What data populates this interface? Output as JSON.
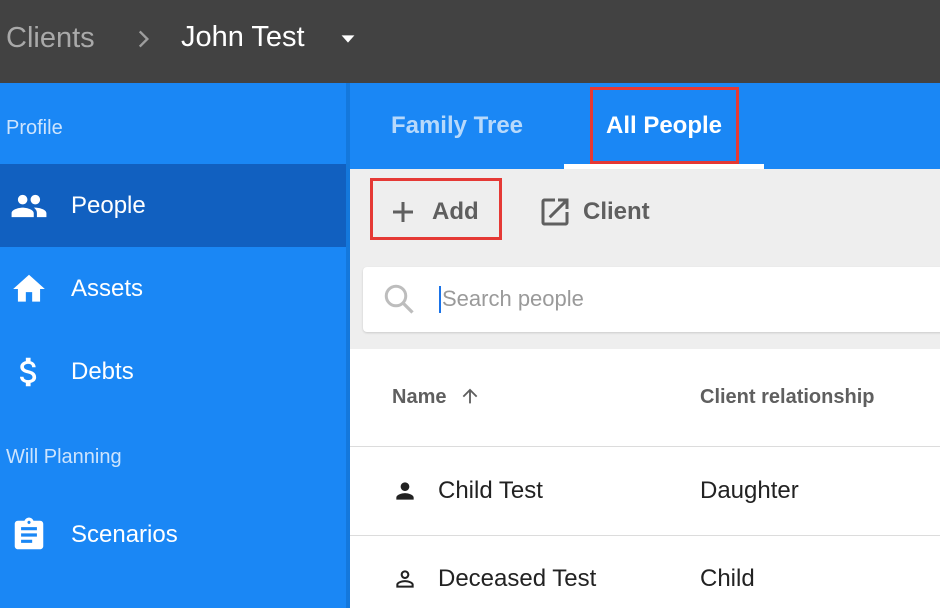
{
  "header": {
    "breadcrumb_parent": "Clients",
    "breadcrumb_current": "John Test"
  },
  "sidebar": {
    "sections": [
      {
        "title": "Profile"
      },
      {
        "title": "Will Planning"
      }
    ],
    "items": [
      {
        "label": "People",
        "icon": "people-icon",
        "active": true
      },
      {
        "label": "Assets",
        "icon": "home-icon",
        "active": false
      },
      {
        "label": "Debts",
        "icon": "dollar-icon",
        "active": false
      },
      {
        "label": "Scenarios",
        "icon": "clipboard-icon",
        "active": false
      }
    ]
  },
  "tabs": [
    {
      "label": "Family Tree",
      "active": false
    },
    {
      "label": "All People",
      "active": true
    }
  ],
  "toolbar": {
    "add_label": "Add",
    "client_label": "Client"
  },
  "search": {
    "placeholder": "Search people"
  },
  "table": {
    "columns": [
      "Name",
      "Client relationship"
    ],
    "sort": {
      "column": "Name",
      "direction": "ascending"
    },
    "rows": [
      {
        "name": "Child Test",
        "relationship": "Daughter",
        "icon": "person-filled-icon"
      },
      {
        "name": "Deceased Test",
        "relationship": "Child",
        "icon": "person-outline-icon"
      }
    ]
  },
  "colors": {
    "topbar": "#424242",
    "sidebar": "#1a87f5",
    "sidebar_active": "#1160c0",
    "highlight": "#e53935"
  }
}
